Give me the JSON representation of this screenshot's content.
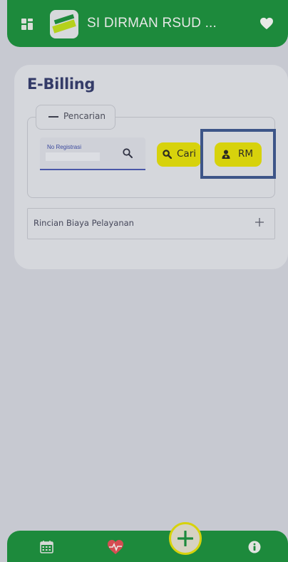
{
  "header": {
    "app_title": "SI DIRMAN RSUD ...",
    "menu_icon": "grid-icon",
    "logo": "app-logo",
    "favorite_icon": "heart-icon"
  },
  "page": {
    "title": "E-Billing"
  },
  "search_panel": {
    "legend_label": "Pencarian",
    "reg_label": "No Registrasi",
    "reg_value": "",
    "search_icon": "search-icon",
    "cari_button": "Cari",
    "rm_button": "RM"
  },
  "accordion": {
    "label": "Rincian Biaya Pelayanan",
    "expand_icon": "plus-icon"
  },
  "bottom_nav": {
    "items": [
      "calendar-icon",
      "heart-pulse-icon",
      "plus-icon",
      "info-icon"
    ]
  },
  "colors": {
    "primary_green": "#1d8a3c",
    "accent_yellow": "#d7d20c",
    "title_navy": "#343b68",
    "highlight_blue": "#3d5588"
  }
}
